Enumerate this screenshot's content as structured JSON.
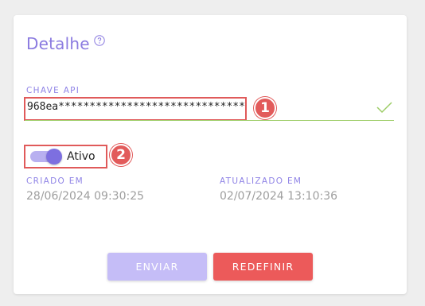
{
  "card": {
    "title": "Detalhe",
    "help_icon": "question-circle-icon"
  },
  "api_key": {
    "label": "CHAVE API",
    "value": "968ea*******************************",
    "valid_icon": "checkmark-icon",
    "callout": "1"
  },
  "status": {
    "label": "Ativo",
    "enabled": true,
    "callout": "2"
  },
  "created": {
    "label": "CRIADO EM",
    "value": "28/06/2024 09:30:25"
  },
  "updated": {
    "label": "ATUALIZADO EM",
    "value": "02/07/2024 13:10:36"
  },
  "actions": {
    "send_label": "ENVIAR",
    "reset_label": "REDEFINIR"
  },
  "colors": {
    "accent": "#8b7be0",
    "danger": "#ec5a5a",
    "success_line": "#9ccc65"
  }
}
